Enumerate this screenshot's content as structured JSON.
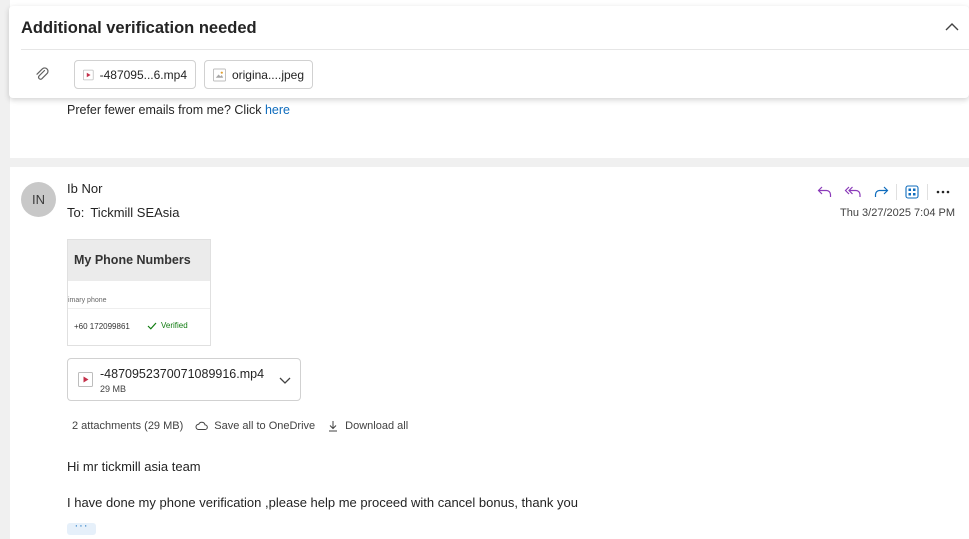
{
  "banner": {
    "title": "Additional verification needed",
    "attachments": [
      {
        "name": "-487095...6.mp4",
        "icon": "video-file-icon"
      },
      {
        "name": "origina....jpeg",
        "icon": "image-file-icon"
      }
    ]
  },
  "previous_message": {
    "footer_text": "Prefer fewer emails from me? Click ",
    "footer_link": "here"
  },
  "message": {
    "avatar_initials": "IN",
    "sender": "Ib Nor",
    "to_label": "To:",
    "recipient": "Tickmill SEAsia",
    "date": "Thu 3/27/2025 7:04 PM",
    "inline_image": {
      "heading": "My Phone Numbers",
      "sub_label": "imary phone",
      "phone": "+60 172099861",
      "status": "Verified"
    },
    "attachment": {
      "name": "-4870952370071089916.mp4",
      "size": "29 MB"
    },
    "attachments_summary": "2 attachments (29 MB)",
    "save_onedrive_label": "Save all to OneDrive",
    "download_all_label": "Download all",
    "body": [
      "Hi mr tickmill asia team",
      "I have done my phone verification ,please help me proceed with cancel bonus, thank you"
    ],
    "more_label": "···"
  },
  "colors": {
    "accent": "#0f6cbd",
    "reply_purple": "#8a3ab9",
    "verified_green": "#107c10"
  }
}
